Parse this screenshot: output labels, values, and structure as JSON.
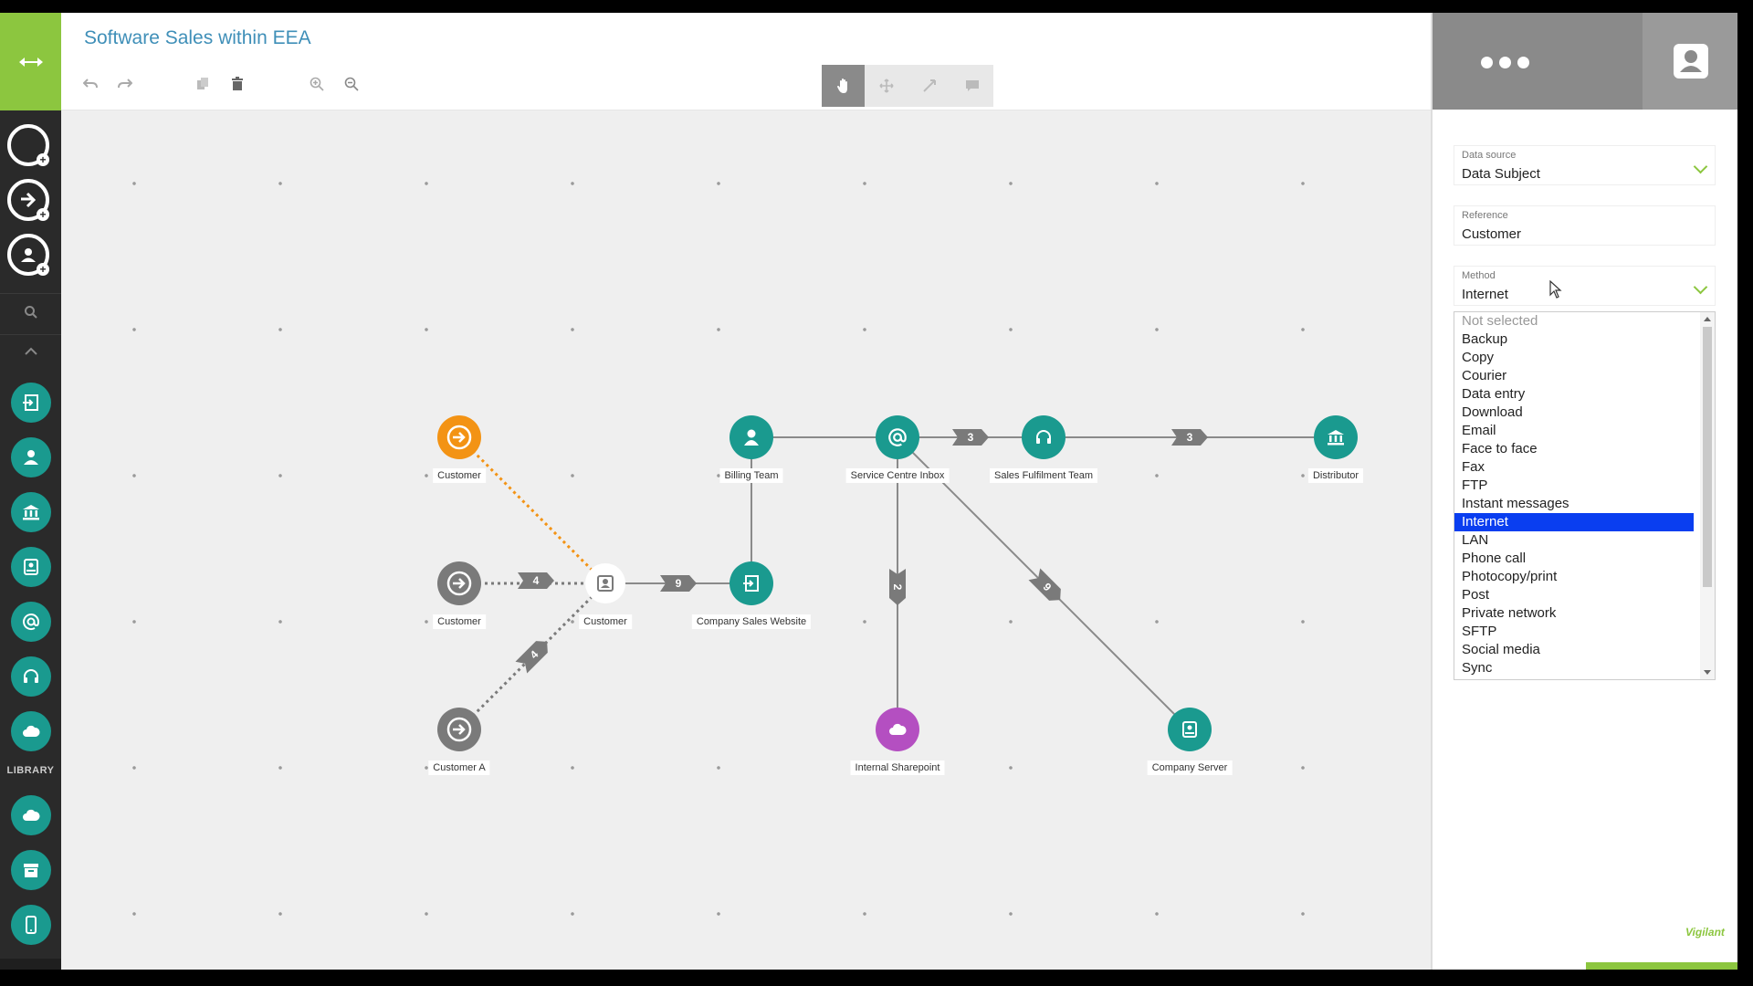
{
  "diagram": {
    "title": "Software Sales within EEA",
    "nodes": [
      {
        "label": "Customer",
        "kind": "arrow",
        "color": "#f39314"
      },
      {
        "label": "Billing Team",
        "kind": "person",
        "color": "#1a9a8f"
      },
      {
        "label": "Service Centre Inbox",
        "kind": "at",
        "color": "#1a9a8f"
      },
      {
        "label": "Sales Fulfilment Team",
        "kind": "headset",
        "color": "#1a9a8f"
      },
      {
        "label": "Distributor",
        "kind": "bank",
        "color": "#1a9a8f"
      },
      {
        "label": "Customer",
        "kind": "arrow",
        "color": "#7a7a7a"
      },
      {
        "label": "Customer",
        "kind": "contact",
        "color": "#ffffff"
      },
      {
        "label": "Company Sales Website",
        "kind": "login",
        "color": "#1a9a8f"
      },
      {
        "label": "Customer A",
        "kind": "arrow",
        "color": "#7a7a7a"
      },
      {
        "label": "Internal Sharepoint",
        "kind": "cloud",
        "color": "#b44fc1"
      },
      {
        "label": "Company Server",
        "kind": "drive",
        "color": "#1a9a8f"
      }
    ],
    "edge_badges": [
      "3",
      "3",
      "4",
      "9",
      "4",
      "2",
      "9"
    ]
  },
  "sidebar": {
    "library_label": "LIBRARY"
  },
  "panel": {
    "data_source": {
      "label": "Data source",
      "value": "Data Subject"
    },
    "reference": {
      "label": "Reference",
      "value": "Customer"
    },
    "method": {
      "label": "Method",
      "value": "Internet"
    },
    "method_options": [
      "Not selected",
      "Backup",
      "Copy",
      "Courier",
      "Data entry",
      "Download",
      "Email",
      "Face to face",
      "Fax",
      "FTP",
      "Instant messages",
      "Internet",
      "LAN",
      "Phone call",
      "Photocopy/print",
      "Post",
      "Private network",
      "SFTP",
      "Social media",
      "Sync"
    ],
    "selected_option": "Internet",
    "logo_text": "Vigilant"
  },
  "colors": {
    "accent_green": "#8cc63f",
    "teal": "#1a9a8f",
    "orange": "#f39314",
    "purple": "#b44fc1",
    "title_blue": "#3f8fb8",
    "selection_blue": "#0a3ef0"
  }
}
